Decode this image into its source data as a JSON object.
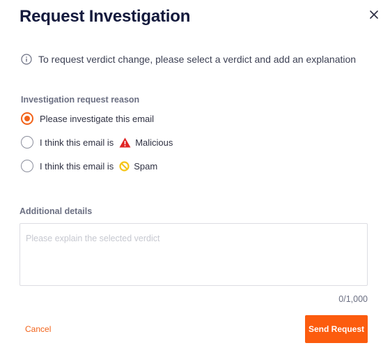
{
  "modal": {
    "title": "Request Investigation",
    "close_icon": "close-icon"
  },
  "info": {
    "icon": "info-icon",
    "text": "To request verdict change, please select a verdict and add an explanation"
  },
  "reason": {
    "label": "Investigation request reason",
    "options": [
      {
        "label": "Please investigate this email",
        "selected": true
      },
      {
        "prefix": "I think this email is",
        "verdict": "Malicious",
        "icon": "warning-icon",
        "icon_color": "#e02424",
        "selected": false
      },
      {
        "prefix": "I think this email is",
        "verdict": "Spam",
        "icon": "spam-icon",
        "icon_color": "#f5c518",
        "selected": false
      }
    ]
  },
  "details": {
    "label": "Additional details",
    "placeholder": "Please explain the selected verdict",
    "value": "",
    "counter": "0/1,000"
  },
  "actions": {
    "cancel_label": "Cancel",
    "send_label": "Send Request"
  },
  "colors": {
    "accent": "#fc5c0e",
    "title": "#141a3d"
  }
}
